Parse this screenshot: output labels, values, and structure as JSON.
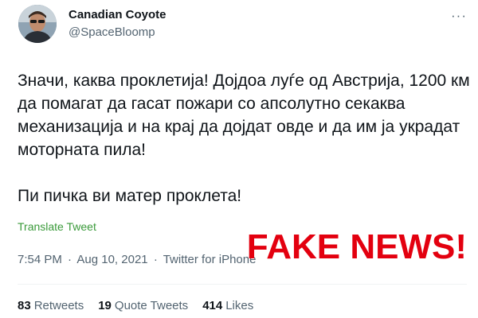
{
  "tweet": {
    "author_name": "Canadian Coyote",
    "author_handle": "@SpaceBloomp",
    "more_icon": "more-dots-icon",
    "paragraph1": "Значи, каква проклетија! Дојдоа луѓе  од Австрија, 1200 км да помагат да гасат пожари со апсолутно секаква механизација и на крај да дојдат овде и да им ја украдат моторната пила!",
    "paragraph2": "Пи пичка ви матер проклета!",
    "translate_label": "Translate Tweet",
    "time": "7:54 PM",
    "date": "Aug 10, 2021",
    "separator": "·",
    "source": "Twitter for iPhone"
  },
  "overlay": {
    "label": "FAKE NEWS!",
    "color": "#e3000f"
  },
  "stats": {
    "retweets_count": "83",
    "retweets_label": "Retweets",
    "quotes_count": "19",
    "quotes_label": "Quote Tweets",
    "likes_count": "414",
    "likes_label": "Likes"
  }
}
